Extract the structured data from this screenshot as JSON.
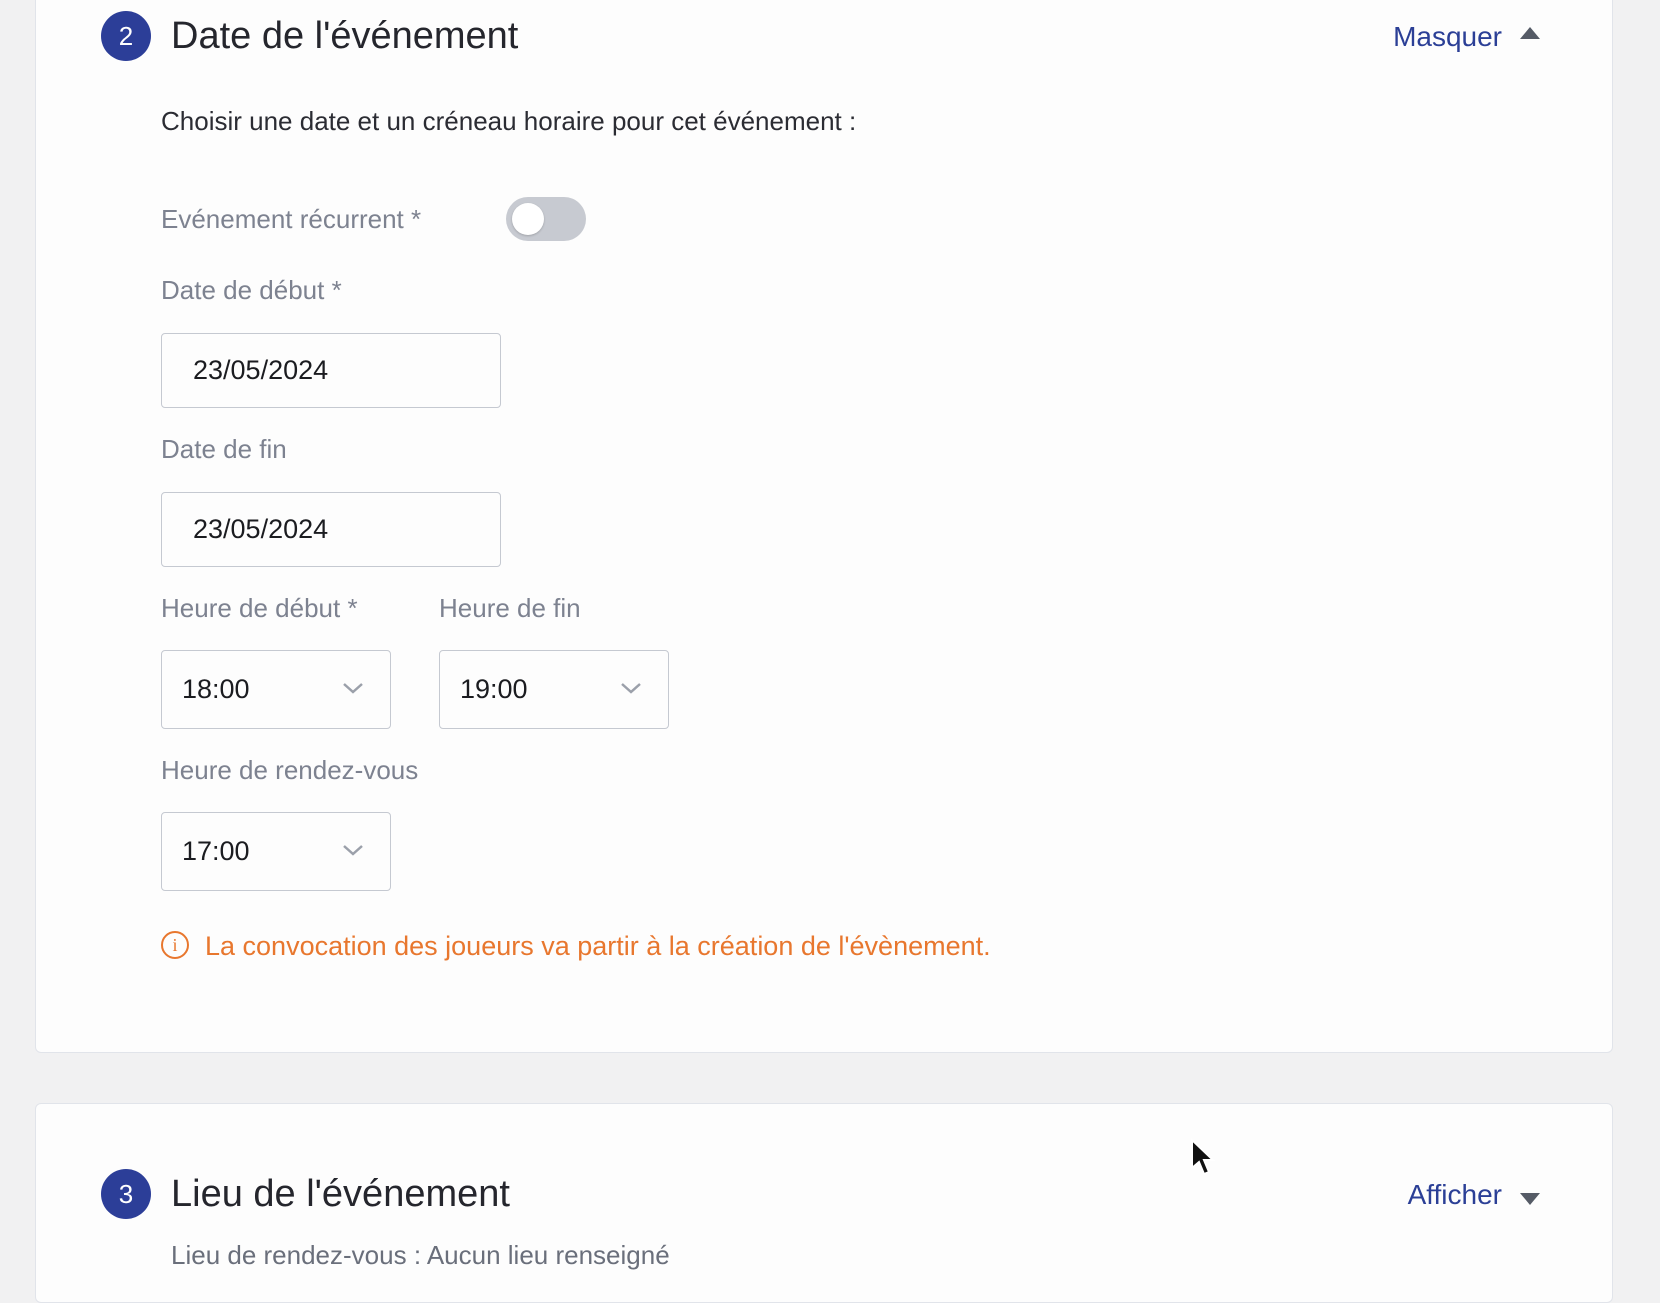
{
  "date_section": {
    "step_number": "2",
    "title": "Date de l'événement",
    "toggle_label": "Masquer",
    "intro": "Choisir une date et un créneau horaire pour cet événement :",
    "recurrent_label": "Evénement récurrent *",
    "recurrent_enabled": false,
    "start_date_label": "Date de début *",
    "start_date_value": "23/05/2024",
    "end_date_label": "Date de fin",
    "end_date_value": "23/05/2024",
    "start_time_label": "Heure de début *",
    "start_time_value": "18:00",
    "end_time_label": "Heure de fin",
    "end_time_value": "19:00",
    "meeting_time_label": "Heure de rendez-vous",
    "meeting_time_value": "17:00",
    "warning": "La convocation des joueurs va partir à la création de l'évènement.",
    "warning_icon": "i"
  },
  "location_section": {
    "step_number": "3",
    "title": "Lieu de l'événement",
    "toggle_label": "Afficher",
    "summary": "Lieu de rendez-vous : Aucun lieu renseigné"
  },
  "colors": {
    "accent": "#2c3e98",
    "link": "#2b3f96",
    "warning": "#e8772e"
  }
}
